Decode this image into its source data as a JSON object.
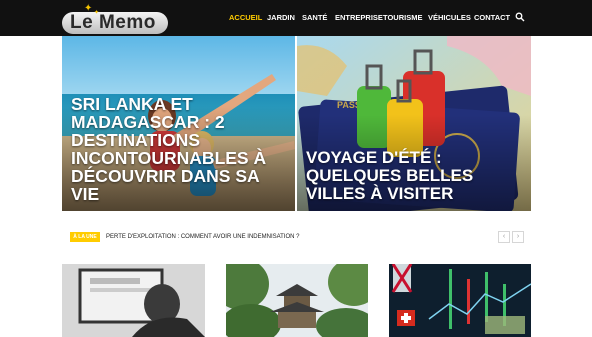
{
  "logo": {
    "text": "Le Memo"
  },
  "nav": {
    "items": [
      {
        "label": "ACCUEIL",
        "active": true
      },
      {
        "label": "JARDIN",
        "active": false
      },
      {
        "label": "SANTÉ",
        "active": false
      },
      {
        "label": "ENTREPRISE",
        "active": false
      },
      {
        "label": "TOURISME",
        "active": false
      },
      {
        "label": "VÉHICULES",
        "active": false
      },
      {
        "label": "CONTACT",
        "active": false
      }
    ],
    "search_icon": "search-icon"
  },
  "hero": [
    {
      "title": "Sri Lanka et Madagascar : 2 destinations incontournables à découvrir dans sa vie"
    },
    {
      "title": "Voyage d'été : quelques belles villes à visiter"
    }
  ],
  "ticker": {
    "badge": "À LA UNE",
    "headline": "PERTE D'EXPLOITATION : COMMENT AVOIR UNE INDEMNISATION ?",
    "prev_icon": "chevron-left-icon",
    "next_icon": "chevron-right-icon"
  },
  "colors": {
    "accent": "#ffcc00",
    "header_bg": "#111111",
    "text": "#222222"
  }
}
